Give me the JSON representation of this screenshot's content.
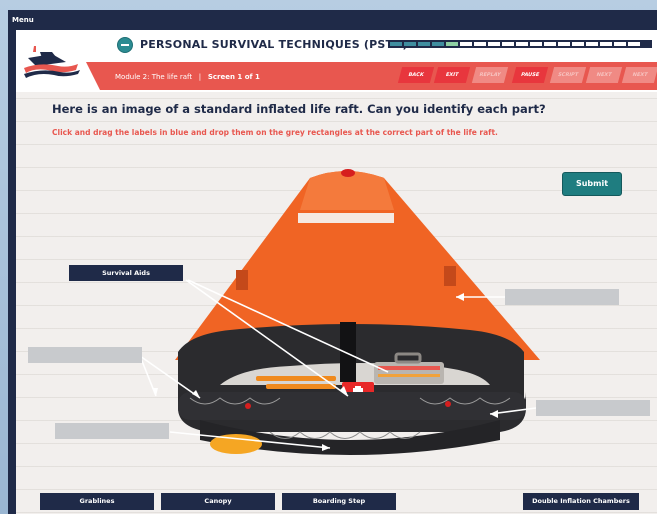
{
  "menu": {
    "label": "Menu"
  },
  "header": {
    "title": "PERSONAL SURVIVAL TECHNIQUES (PSTU)",
    "module": "Module 2: The life raft",
    "separator": "|",
    "screen": "Screen 1 of 1"
  },
  "nav": {
    "buttons": [
      {
        "label": "BACK",
        "enabled": true
      },
      {
        "label": "EXIT",
        "enabled": true
      },
      {
        "label": "REPLAY",
        "enabled": false
      },
      {
        "label": "PAUSE",
        "enabled": true
      },
      {
        "label": "SCRIPT",
        "enabled": false
      },
      {
        "label": "NEXT",
        "enabled": false
      },
      {
        "label": "NEXT",
        "enabled": false
      }
    ]
  },
  "content": {
    "question": "Here is an image of a standard inflated life raft. Can you identify each part?",
    "instruction": "Click and drag the labels in blue and drop them on the grey rectangles at the correct part of the life raft.",
    "submit_label": "Submit"
  },
  "placed_label": {
    "text": "Survival Aids"
  },
  "drag_labels": [
    "Grablines",
    "Canopy",
    "Boarding Step",
    "Double Inflation Chambers"
  ],
  "colors": {
    "navy": "#1f2a48",
    "accent_red": "#e8574f",
    "teal": "#1f7d80",
    "raft_orange": "#f06424",
    "raft_black": "#2b2b2e"
  }
}
